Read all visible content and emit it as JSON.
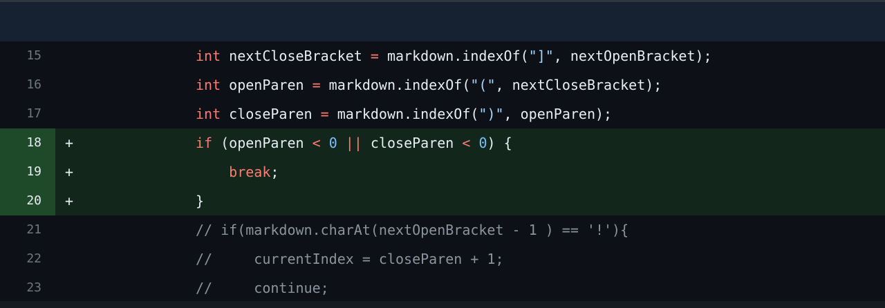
{
  "diff": {
    "lines": [
      {
        "num": "15",
        "marker": "",
        "type": "context",
        "indent": "",
        "code": "int nextCloseBracket = markdown.indexOf(\"]\", nextOpenBracket);"
      },
      {
        "num": "16",
        "marker": "",
        "type": "context",
        "indent": "",
        "code": "int openParen = markdown.indexOf(\"(\", nextCloseBracket);"
      },
      {
        "num": "17",
        "marker": "",
        "type": "context",
        "indent": "",
        "code": "int closeParen = markdown.indexOf(\")\", openParen);"
      },
      {
        "num": "18",
        "marker": "+",
        "type": "added",
        "indent": "",
        "code": "if (openParen < 0 || closeParen < 0) {"
      },
      {
        "num": "19",
        "marker": "+",
        "type": "added",
        "indent": "    ",
        "code": "break;"
      },
      {
        "num": "20",
        "marker": "+",
        "type": "added",
        "indent": "",
        "code": "}"
      },
      {
        "num": "21",
        "marker": "",
        "type": "context",
        "indent": "",
        "code": "// if(markdown.charAt(nextOpenBracket - 1 ) == '!'){"
      },
      {
        "num": "22",
        "marker": "",
        "type": "context",
        "indent": "",
        "code": "//     currentIndex = closeParen + 1;"
      },
      {
        "num": "23",
        "marker": "",
        "type": "context",
        "indent": "",
        "code": "//     continue;"
      }
    ]
  }
}
